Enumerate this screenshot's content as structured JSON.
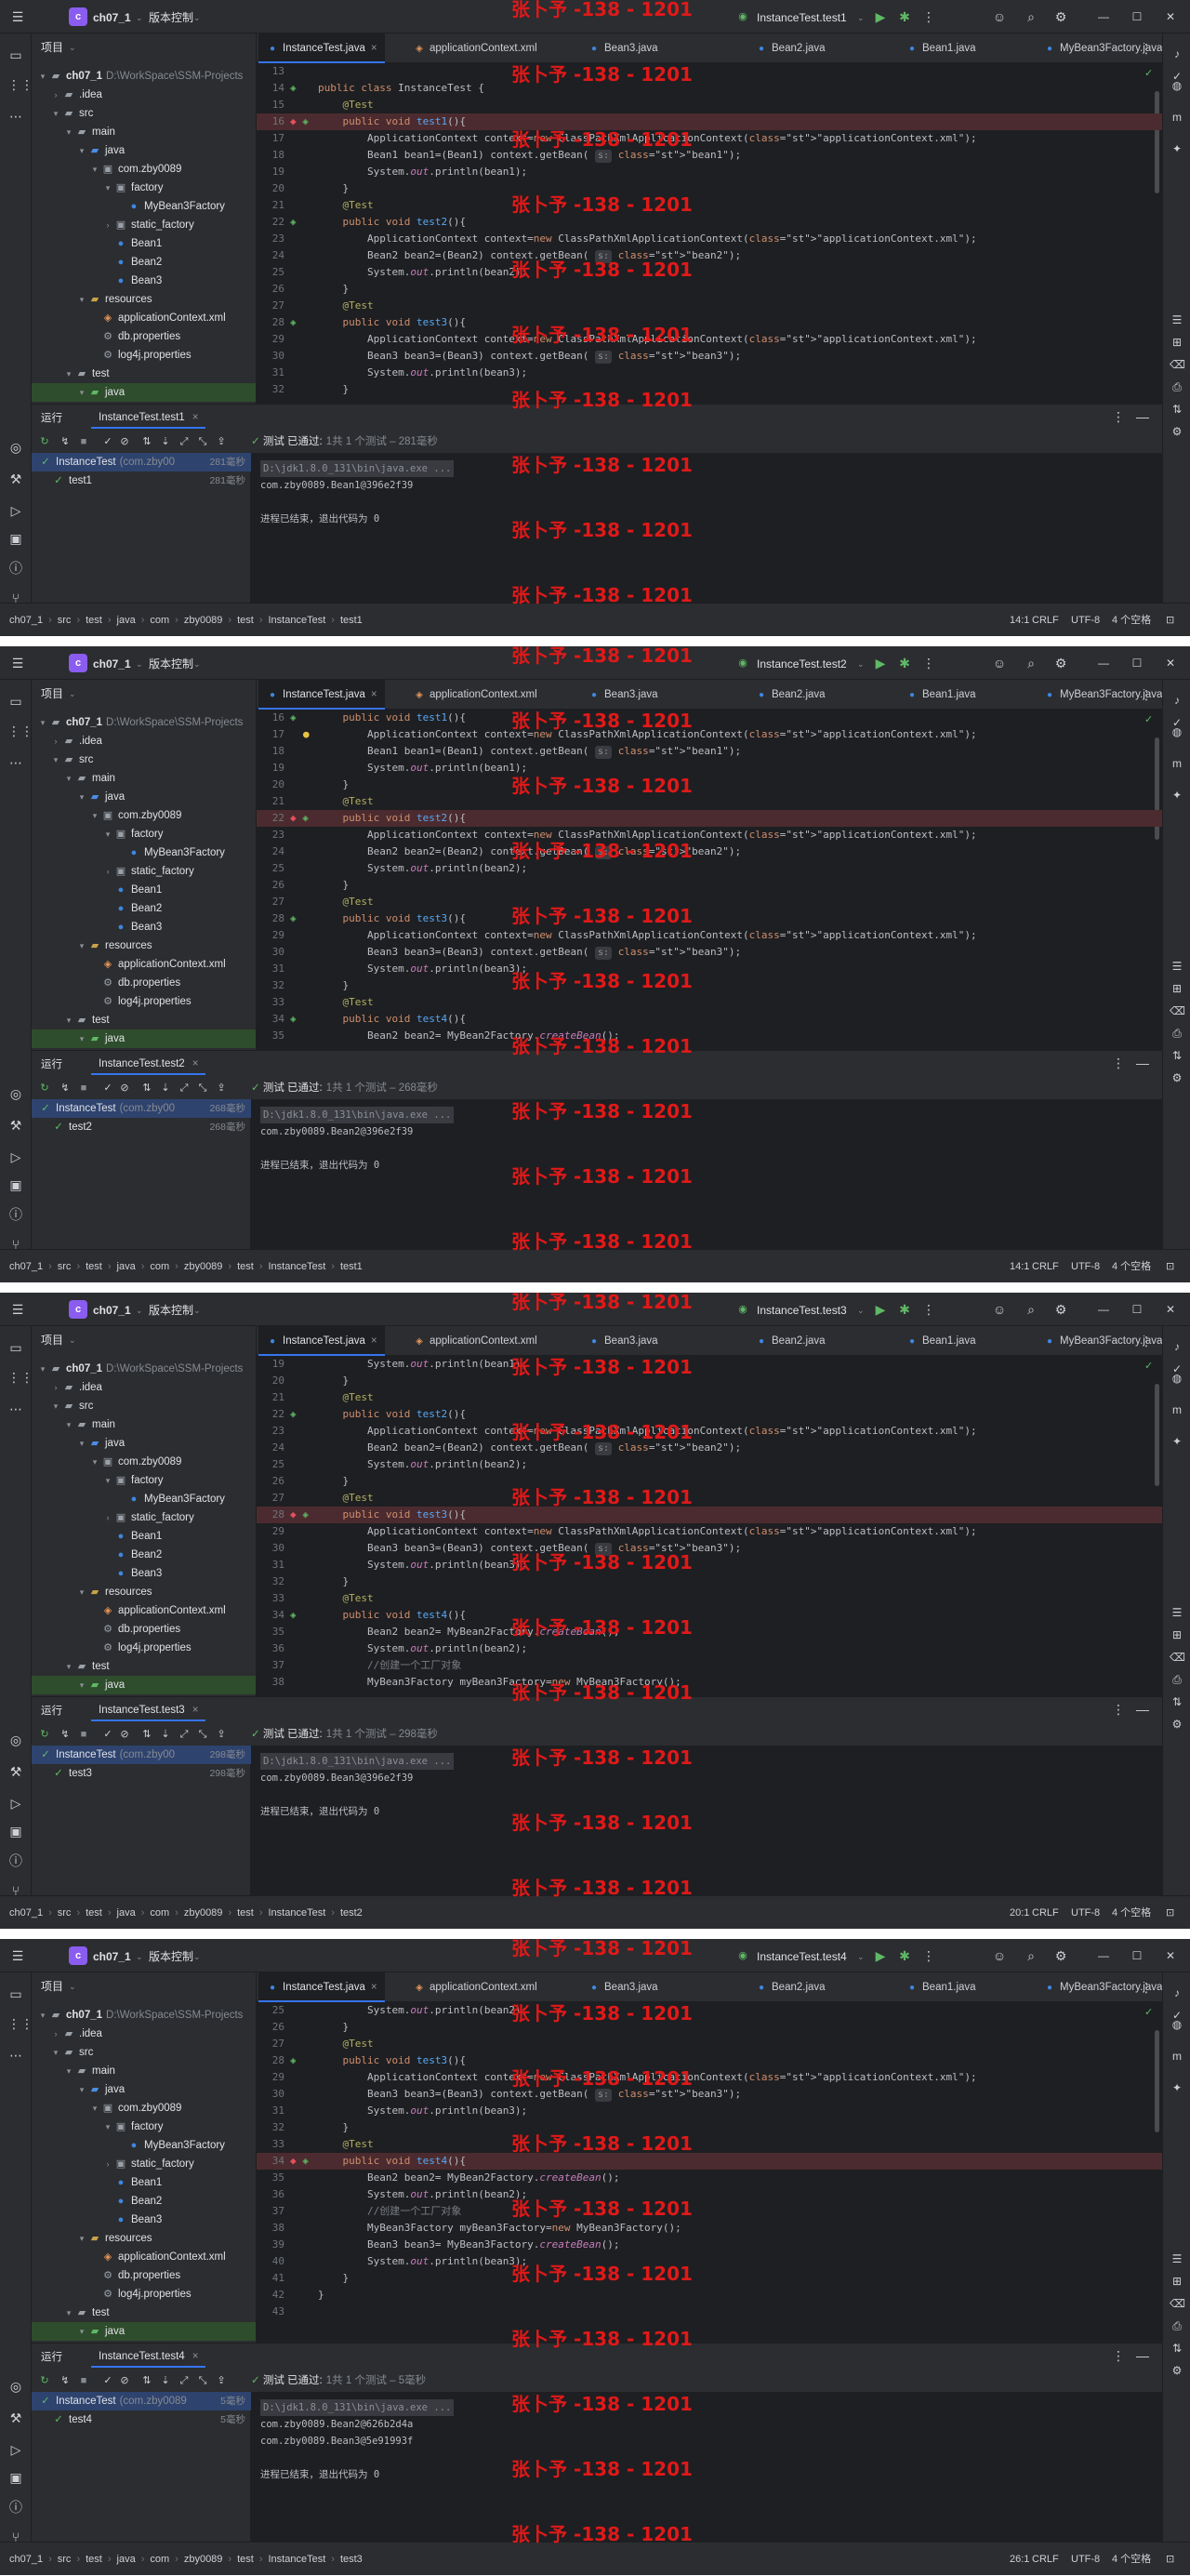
{
  "app": {
    "project_name": "ch07_1",
    "project_initial": "c",
    "vcs_label": "版本控制",
    "window_controls": [
      "—",
      "☐",
      "✕"
    ]
  },
  "watermark_text": "张卜予 -138 - 1201",
  "colors": {
    "background": "#1e1f22",
    "toolbar": "#2b2d30",
    "accent": "#3574f0",
    "breakpoint_line": "#4b2b2f",
    "watermark": "#e01919",
    "pass": "#5fb865"
  },
  "project_panel": {
    "title": "项目",
    "tree": [
      {
        "label": "ch07_1",
        "muted": "D:\\WorkSpace\\SSM-Projects",
        "depth": 0,
        "icon": "folder-icon",
        "arrow": "▾",
        "bold": true
      },
      {
        "label": ".idea",
        "depth": 1,
        "icon": "folder-icon",
        "arrow": "›"
      },
      {
        "label": "src",
        "depth": 1,
        "icon": "folder-icon",
        "arrow": "▾"
      },
      {
        "label": "main",
        "depth": 2,
        "icon": "folder-icon",
        "arrow": "▾"
      },
      {
        "label": "java",
        "depth": 3,
        "icon": "source-folder-icon",
        "arrow": "▾"
      },
      {
        "label": "com.zby0089",
        "depth": 4,
        "icon": "package-icon",
        "arrow": "▾"
      },
      {
        "label": "factory",
        "depth": 5,
        "icon": "package-icon",
        "arrow": "▾"
      },
      {
        "label": "MyBean3Factory",
        "depth": 6,
        "icon": "class-icon",
        "arrow": ""
      },
      {
        "label": "static_factory",
        "depth": 5,
        "icon": "package-icon",
        "arrow": "›"
      },
      {
        "label": "Bean1",
        "depth": 5,
        "icon": "class-icon",
        "arrow": ""
      },
      {
        "label": "Bean2",
        "depth": 5,
        "icon": "class-icon",
        "arrow": ""
      },
      {
        "label": "Bean3",
        "depth": 5,
        "icon": "class-icon",
        "arrow": ""
      },
      {
        "label": "resources",
        "depth": 3,
        "icon": "resources-folder-icon",
        "arrow": "▾"
      },
      {
        "label": "applicationContext.xml",
        "depth": 4,
        "icon": "xml-file-icon",
        "arrow": ""
      },
      {
        "label": "db.properties",
        "depth": 4,
        "icon": "properties-file-icon",
        "arrow": ""
      },
      {
        "label": "log4j.properties",
        "depth": 4,
        "icon": "properties-file-icon",
        "arrow": ""
      },
      {
        "label": "test",
        "depth": 2,
        "icon": "folder-icon",
        "arrow": "▾"
      },
      {
        "label": "java",
        "depth": 3,
        "icon": "test-folder-icon",
        "arrow": "▾",
        "selected": true
      }
    ]
  },
  "editor_tabs": [
    "InstanceTest.java",
    "applicationContext.xml",
    "Bean3.java",
    "Bean2.java",
    "Bean1.java",
    "MyBean3Factory.java"
  ],
  "run_panel_title": "运行",
  "encoding": {
    "line_sep": "CRLF",
    "charset": "UTF-8",
    "indent": "4 个空格"
  },
  "screens": [
    {
      "run_config": "InstanceTest.test1",
      "breadcrumbs": [
        "ch07_1",
        "src",
        "test",
        "java",
        "com",
        "zby0089",
        "test",
        "InstanceTest",
        "test1"
      ],
      "cursor": "14:1",
      "test_class": "InstanceTest",
      "test_class_pkg": "(com.zby00",
      "test_class_time": "281毫秒",
      "test_method": "test1",
      "test_method_time": "281毫秒",
      "status_pass": "测试 已通过:",
      "status_detail": "1共 1 个测试 – 281毫秒",
      "console": [
        "D:\\jdk1.8.0_131\\bin\\java.exe ...",
        "com.zby0089.Bean1@396e2f39",
        "",
        "进程已结束，退出代码为 0"
      ],
      "code": [
        {
          "n": "13",
          "t": ""
        },
        {
          "n": "14",
          "t": "public class InstanceTest {",
          "g": "run"
        },
        {
          "n": "15",
          "t": "    @Test"
        },
        {
          "n": "16",
          "t": "    public void test1(){",
          "g": "bp",
          "bp": true
        },
        {
          "n": "17",
          "t": "        ApplicationContext context=new ClassPathXmlApplicationContext(\"applicationContext.xml\");"
        },
        {
          "n": "18",
          "t": "        Bean1 bean1=(Bean1) context.getBean( s: \"bean1\");"
        },
        {
          "n": "19",
          "t": "        System.out.println(bean1);"
        },
        {
          "n": "20",
          "t": "    }"
        },
        {
          "n": "21",
          "t": "    @Test"
        },
        {
          "n": "22",
          "t": "    public void test2(){",
          "g": "run"
        },
        {
          "n": "23",
          "t": "        ApplicationContext context=new ClassPathXmlApplicationContext(\"applicationContext.xml\");"
        },
        {
          "n": "24",
          "t": "        Bean2 bean2=(Bean2) context.getBean( s: \"bean2\");"
        },
        {
          "n": "25",
          "t": "        System.out.println(bean2);"
        },
        {
          "n": "26",
          "t": "    }"
        },
        {
          "n": "27",
          "t": "    @Test"
        },
        {
          "n": "28",
          "t": "    public void test3(){",
          "g": "run"
        },
        {
          "n": "29",
          "t": "        ApplicationContext context=new ClassPathXmlApplicationContext(\"applicationContext.xml\");"
        },
        {
          "n": "30",
          "t": "        Bean3 bean3=(Bean3) context.getBean( s: \"bean3\");"
        },
        {
          "n": "31",
          "t": "        System.out.println(bean3);"
        },
        {
          "n": "32",
          "t": "    }"
        }
      ]
    },
    {
      "run_config": "InstanceTest.test2",
      "breadcrumbs": [
        "ch07_1",
        "src",
        "test",
        "java",
        "com",
        "zby0089",
        "test",
        "InstanceTest",
        "test1"
      ],
      "cursor": "14:1",
      "test_class": "InstanceTest",
      "test_class_pkg": "(com.zby00",
      "test_class_time": "268毫秒",
      "test_method": "test2",
      "test_method_time": "268毫秒",
      "status_pass": "测试 已通过:",
      "status_detail": "1共 1 个测试 – 268毫秒",
      "console": [
        "D:\\jdk1.8.0_131\\bin\\java.exe ...",
        "com.zby0089.Bean2@396e2f39",
        "",
        "进程已结束，退出代码为 0"
      ],
      "code": [
        {
          "n": "16",
          "t": "    public void test1(){",
          "g": "run"
        },
        {
          "n": "17",
          "t": "        ApplicationContext context=new ClassPathXmlApplicationContext(\"applicationContext.xml\");",
          "g": "bulb"
        },
        {
          "n": "18",
          "t": "        Bean1 bean1=(Bean1) context.getBean( s: \"bean1\");"
        },
        {
          "n": "19",
          "t": "        System.out.println(bean1);"
        },
        {
          "n": "20",
          "t": "    }"
        },
        {
          "n": "21",
          "t": "    @Test"
        },
        {
          "n": "22",
          "t": "    public void test2(){",
          "g": "bp",
          "bp": true
        },
        {
          "n": "23",
          "t": "        ApplicationContext context=new ClassPathXmlApplicationContext(\"applicationContext.xml\");"
        },
        {
          "n": "24",
          "t": "        Bean2 bean2=(Bean2) context.getBean( s: \"bean2\");"
        },
        {
          "n": "25",
          "t": "        System.out.println(bean2);"
        },
        {
          "n": "26",
          "t": "    }"
        },
        {
          "n": "27",
          "t": "    @Test"
        },
        {
          "n": "28",
          "t": "    public void test3(){",
          "g": "run"
        },
        {
          "n": "29",
          "t": "        ApplicationContext context=new ClassPathXmlApplicationContext(\"applicationContext.xml\");"
        },
        {
          "n": "30",
          "t": "        Bean3 bean3=(Bean3) context.getBean( s: \"bean3\");"
        },
        {
          "n": "31",
          "t": "        System.out.println(bean3);"
        },
        {
          "n": "32",
          "t": "    }"
        },
        {
          "n": "33",
          "t": "    @Test"
        },
        {
          "n": "34",
          "t": "    public void test4(){",
          "g": "run"
        },
        {
          "n": "35",
          "t": "        Bean2 bean2= MyBean2Factory.createBean();"
        }
      ]
    },
    {
      "run_config": "InstanceTest.test3",
      "breadcrumbs": [
        "ch07_1",
        "src",
        "test",
        "java",
        "com",
        "zby0089",
        "test",
        "InstanceTest",
        "test2"
      ],
      "cursor": "20:1",
      "test_class": "InstanceTest",
      "test_class_pkg": "(com.zby00",
      "test_class_time": "298毫秒",
      "test_method": "test3",
      "test_method_time": "298毫秒",
      "status_pass": "测试 已通过:",
      "status_detail": "1共 1 个测试 – 298毫秒",
      "console": [
        "D:\\jdk1.8.0_131\\bin\\java.exe ...",
        "com.zby0089.Bean3@396e2f39",
        "",
        "进程已结束，退出代码为 0"
      ],
      "code": [
        {
          "n": "19",
          "t": "        System.out.println(bean1);"
        },
        {
          "n": "20",
          "t": "    }"
        },
        {
          "n": "21",
          "t": "    @Test"
        },
        {
          "n": "22",
          "t": "    public void test2(){",
          "g": "run"
        },
        {
          "n": "23",
          "t": "        ApplicationContext context=new ClassPathXmlApplicationContext(\"applicationContext.xml\");"
        },
        {
          "n": "24",
          "t": "        Bean2 bean2=(Bean2) context.getBean( s: \"bean2\");"
        },
        {
          "n": "25",
          "t": "        System.out.println(bean2);"
        },
        {
          "n": "26",
          "t": "    }"
        },
        {
          "n": "27",
          "t": "    @Test"
        },
        {
          "n": "28",
          "t": "    public void test3(){",
          "g": "bp",
          "bp": true
        },
        {
          "n": "29",
          "t": "        ApplicationContext context=new ClassPathXmlApplicationContext(\"applicationContext.xml\");"
        },
        {
          "n": "30",
          "t": "        Bean3 bean3=(Bean3) context.getBean( s: \"bean3\");"
        },
        {
          "n": "31",
          "t": "        System.out.println(bean3);"
        },
        {
          "n": "32",
          "t": "    }"
        },
        {
          "n": "33",
          "t": "    @Test"
        },
        {
          "n": "34",
          "t": "    public void test4(){",
          "g": "run"
        },
        {
          "n": "35",
          "t": "        Bean2 bean2= MyBean2Factory.createBean();"
        },
        {
          "n": "36",
          "t": "        System.out.println(bean2);"
        },
        {
          "n": "37",
          "t": "        //创建一个工厂对象"
        },
        {
          "n": "38",
          "t": "        MyBean3Factory myBean3Factory=new MyBean3Factory();"
        }
      ]
    },
    {
      "run_config": "InstanceTest.test4",
      "breadcrumbs": [
        "ch07_1",
        "src",
        "test",
        "java",
        "com",
        "zby0089",
        "test",
        "InstanceTest",
        "test3"
      ],
      "cursor": "26:1",
      "test_class": "InstanceTest",
      "test_class_pkg": "(com.zby0089",
      "test_class_time": "5毫秒",
      "test_method": "test4",
      "test_method_time": "5毫秒",
      "status_pass": "测试 已通过:",
      "status_detail": "1共 1 个测试 – 5毫秒",
      "console": [
        "D:\\jdk1.8.0_131\\bin\\java.exe ...",
        "com.zby0089.Bean2@626b2d4a",
        "com.zby0089.Bean3@5e91993f",
        "",
        "进程已结束，退出代码为 0"
      ],
      "code": [
        {
          "n": "25",
          "t": "        System.out.println(bean2);"
        },
        {
          "n": "26",
          "t": "    }"
        },
        {
          "n": "27",
          "t": "    @Test"
        },
        {
          "n": "28",
          "t": "    public void test3(){",
          "g": "run"
        },
        {
          "n": "29",
          "t": "        ApplicationContext context=new ClassPathXmlApplicationContext(\"applicationContext.xml\");"
        },
        {
          "n": "30",
          "t": "        Bean3 bean3=(Bean3) context.getBean( s: \"bean3\");"
        },
        {
          "n": "31",
          "t": "        System.out.println(bean3);"
        },
        {
          "n": "32",
          "t": "    }"
        },
        {
          "n": "33",
          "t": "    @Test"
        },
        {
          "n": "34",
          "t": "    public void test4(){",
          "g": "bp",
          "bp": true
        },
        {
          "n": "35",
          "t": "        Bean2 bean2= MyBean2Factory.createBean();"
        },
        {
          "n": "36",
          "t": "        System.out.println(bean2);"
        },
        {
          "n": "37",
          "t": "        //创建一个工厂对象"
        },
        {
          "n": "38",
          "t": "        MyBean3Factory myBean3Factory=new MyBean3Factory();"
        },
        {
          "n": "39",
          "t": "        Bean3 bean3= MyBean3Factory.createBean();"
        },
        {
          "n": "40",
          "t": "        System.out.println(bean3);"
        },
        {
          "n": "41",
          "t": "    }"
        },
        {
          "n": "42",
          "t": "}"
        },
        {
          "n": "43",
          "t": ""
        }
      ]
    }
  ]
}
